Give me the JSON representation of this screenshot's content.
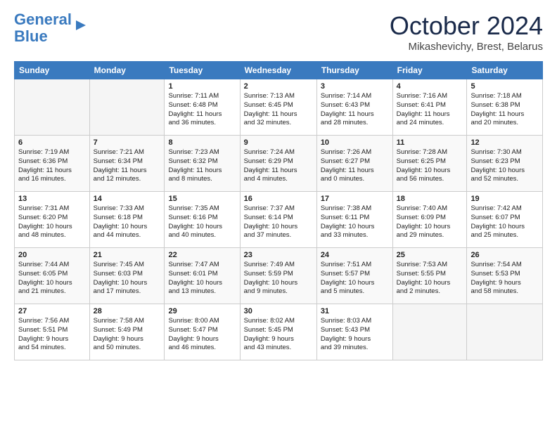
{
  "header": {
    "logo_line1": "General",
    "logo_line2": "Blue",
    "month": "October 2024",
    "location": "Mikashevichy, Brest, Belarus"
  },
  "weekdays": [
    "Sunday",
    "Monday",
    "Tuesday",
    "Wednesday",
    "Thursday",
    "Friday",
    "Saturday"
  ],
  "weeks": [
    [
      {
        "day": "",
        "info": ""
      },
      {
        "day": "",
        "info": ""
      },
      {
        "day": "1",
        "info": "Sunrise: 7:11 AM\nSunset: 6:48 PM\nDaylight: 11 hours\nand 36 minutes."
      },
      {
        "day": "2",
        "info": "Sunrise: 7:13 AM\nSunset: 6:45 PM\nDaylight: 11 hours\nand 32 minutes."
      },
      {
        "day": "3",
        "info": "Sunrise: 7:14 AM\nSunset: 6:43 PM\nDaylight: 11 hours\nand 28 minutes."
      },
      {
        "day": "4",
        "info": "Sunrise: 7:16 AM\nSunset: 6:41 PM\nDaylight: 11 hours\nand 24 minutes."
      },
      {
        "day": "5",
        "info": "Sunrise: 7:18 AM\nSunset: 6:38 PM\nDaylight: 11 hours\nand 20 minutes."
      }
    ],
    [
      {
        "day": "6",
        "info": "Sunrise: 7:19 AM\nSunset: 6:36 PM\nDaylight: 11 hours\nand 16 minutes."
      },
      {
        "day": "7",
        "info": "Sunrise: 7:21 AM\nSunset: 6:34 PM\nDaylight: 11 hours\nand 12 minutes."
      },
      {
        "day": "8",
        "info": "Sunrise: 7:23 AM\nSunset: 6:32 PM\nDaylight: 11 hours\nand 8 minutes."
      },
      {
        "day": "9",
        "info": "Sunrise: 7:24 AM\nSunset: 6:29 PM\nDaylight: 11 hours\nand 4 minutes."
      },
      {
        "day": "10",
        "info": "Sunrise: 7:26 AM\nSunset: 6:27 PM\nDaylight: 11 hours\nand 0 minutes."
      },
      {
        "day": "11",
        "info": "Sunrise: 7:28 AM\nSunset: 6:25 PM\nDaylight: 10 hours\nand 56 minutes."
      },
      {
        "day": "12",
        "info": "Sunrise: 7:30 AM\nSunset: 6:23 PM\nDaylight: 10 hours\nand 52 minutes."
      }
    ],
    [
      {
        "day": "13",
        "info": "Sunrise: 7:31 AM\nSunset: 6:20 PM\nDaylight: 10 hours\nand 48 minutes."
      },
      {
        "day": "14",
        "info": "Sunrise: 7:33 AM\nSunset: 6:18 PM\nDaylight: 10 hours\nand 44 minutes."
      },
      {
        "day": "15",
        "info": "Sunrise: 7:35 AM\nSunset: 6:16 PM\nDaylight: 10 hours\nand 40 minutes."
      },
      {
        "day": "16",
        "info": "Sunrise: 7:37 AM\nSunset: 6:14 PM\nDaylight: 10 hours\nand 37 minutes."
      },
      {
        "day": "17",
        "info": "Sunrise: 7:38 AM\nSunset: 6:11 PM\nDaylight: 10 hours\nand 33 minutes."
      },
      {
        "day": "18",
        "info": "Sunrise: 7:40 AM\nSunset: 6:09 PM\nDaylight: 10 hours\nand 29 minutes."
      },
      {
        "day": "19",
        "info": "Sunrise: 7:42 AM\nSunset: 6:07 PM\nDaylight: 10 hours\nand 25 minutes."
      }
    ],
    [
      {
        "day": "20",
        "info": "Sunrise: 7:44 AM\nSunset: 6:05 PM\nDaylight: 10 hours\nand 21 minutes."
      },
      {
        "day": "21",
        "info": "Sunrise: 7:45 AM\nSunset: 6:03 PM\nDaylight: 10 hours\nand 17 minutes."
      },
      {
        "day": "22",
        "info": "Sunrise: 7:47 AM\nSunset: 6:01 PM\nDaylight: 10 hours\nand 13 minutes."
      },
      {
        "day": "23",
        "info": "Sunrise: 7:49 AM\nSunset: 5:59 PM\nDaylight: 10 hours\nand 9 minutes."
      },
      {
        "day": "24",
        "info": "Sunrise: 7:51 AM\nSunset: 5:57 PM\nDaylight: 10 hours\nand 5 minutes."
      },
      {
        "day": "25",
        "info": "Sunrise: 7:53 AM\nSunset: 5:55 PM\nDaylight: 10 hours\nand 2 minutes."
      },
      {
        "day": "26",
        "info": "Sunrise: 7:54 AM\nSunset: 5:53 PM\nDaylight: 9 hours\nand 58 minutes."
      }
    ],
    [
      {
        "day": "27",
        "info": "Sunrise: 7:56 AM\nSunset: 5:51 PM\nDaylight: 9 hours\nand 54 minutes."
      },
      {
        "day": "28",
        "info": "Sunrise: 7:58 AM\nSunset: 5:49 PM\nDaylight: 9 hours\nand 50 minutes."
      },
      {
        "day": "29",
        "info": "Sunrise: 8:00 AM\nSunset: 5:47 PM\nDaylight: 9 hours\nand 46 minutes."
      },
      {
        "day": "30",
        "info": "Sunrise: 8:02 AM\nSunset: 5:45 PM\nDaylight: 9 hours\nand 43 minutes."
      },
      {
        "day": "31",
        "info": "Sunrise: 8:03 AM\nSunset: 5:43 PM\nDaylight: 9 hours\nand 39 minutes."
      },
      {
        "day": "",
        "info": ""
      },
      {
        "day": "",
        "info": ""
      }
    ]
  ]
}
